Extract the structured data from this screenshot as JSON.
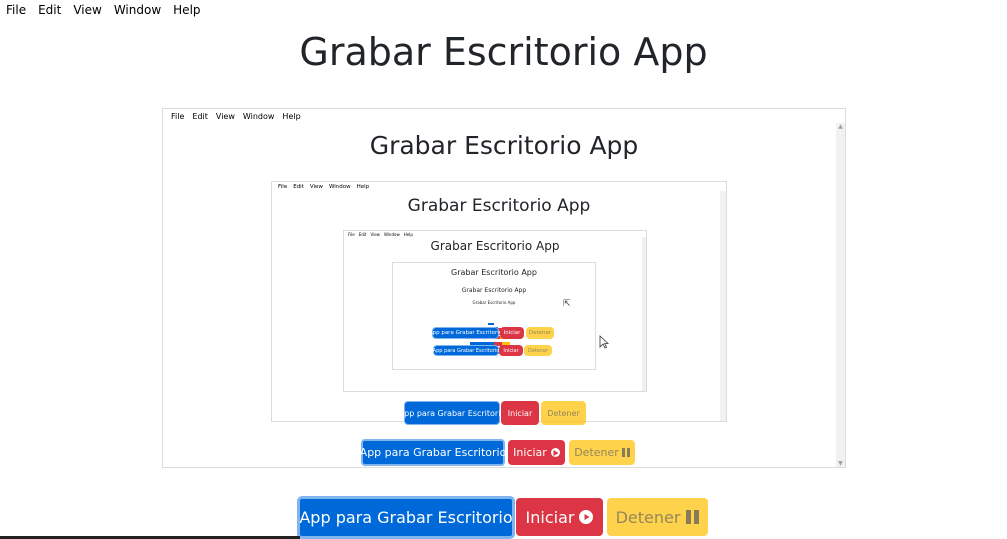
{
  "menu": {
    "items": [
      "File",
      "Edit",
      "View",
      "Window",
      "Help"
    ]
  },
  "app": {
    "title": "Grabar Escritorio App",
    "record_app_button": "App para Grabar Escritorio",
    "start_button": "Iniciar",
    "stop_button": "Detener"
  },
  "colors": {
    "primary": "#0069d9",
    "danger": "#dc3545",
    "warning": "#ffc107",
    "text": "#212529"
  },
  "icons": {
    "play": "play-circle-icon",
    "pause": "pause-icon"
  }
}
